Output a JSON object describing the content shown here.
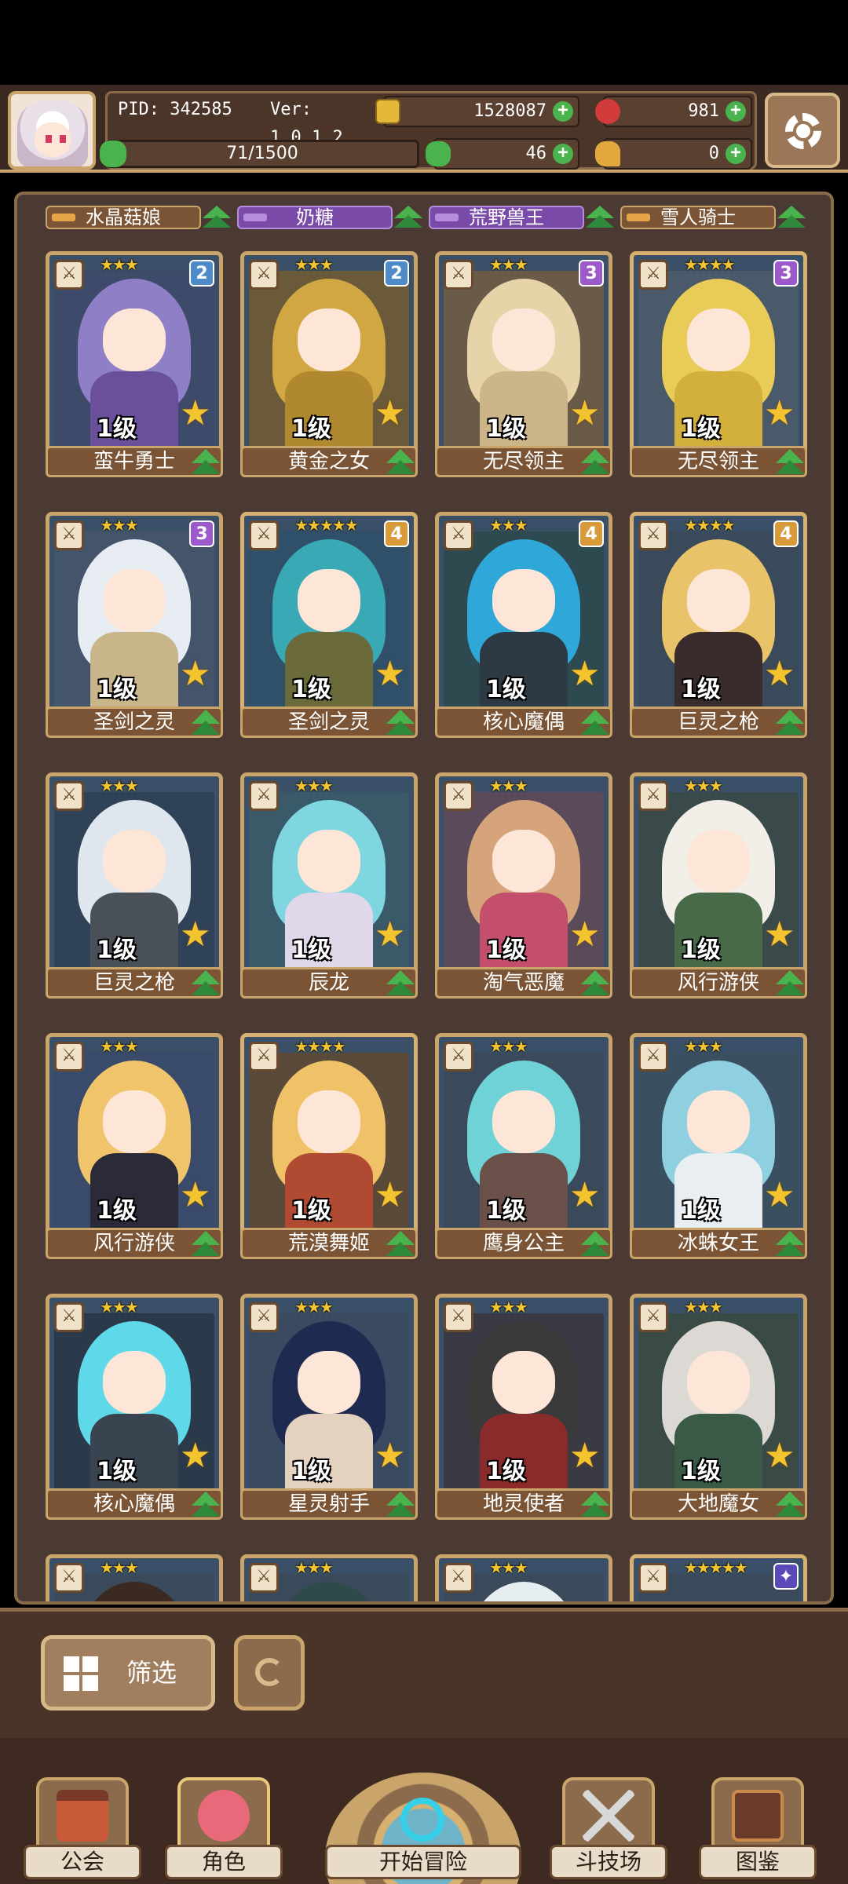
{
  "header": {
    "pid": "PID: 342585",
    "version": "Ver: 1.0.1.2",
    "gold": "1528087",
    "ruby": "981",
    "stamina": "71/1500",
    "clover": "46",
    "chicken": "0"
  },
  "name_row": [
    {
      "name": "水晶菇娘",
      "style": "brown"
    },
    {
      "name": "奶糖",
      "style": "purple"
    },
    {
      "name": "荒野兽王",
      "style": "purple"
    },
    {
      "name": "雪人骑士",
      "style": "brown"
    }
  ],
  "cards": [
    {
      "name": "蛮牛勇士",
      "level": "1级",
      "stars": "★★★",
      "badge": "2",
      "badge_color": "#4f8ac9",
      "hair": "#8e7fc7",
      "bg": "#3d4a6a",
      "body": "#6a4f9a"
    },
    {
      "name": "黄金之女",
      "level": "1级",
      "stars": "★★★",
      "badge": "2",
      "badge_color": "#4f8ac9",
      "hair": "#d1a744",
      "bg": "#6a5a3a",
      "body": "#b08830"
    },
    {
      "name": "无尽领主",
      "level": "1级",
      "stars": "★★★",
      "badge": "3",
      "badge_color": "#9b59c9",
      "hair": "#e7d3a8",
      "bg": "#6a5a48",
      "body": "#cdb58a"
    },
    {
      "name": "无尽领主",
      "level": "1级",
      "stars": "★★★★",
      "badge": "3",
      "badge_color": "#9b59c9",
      "hair": "#e9cc58",
      "bg": "#4a5a6a",
      "body": "#d3b03c"
    },
    {
      "name": "圣剑之灵",
      "level": "1级",
      "stars": "★★★",
      "badge": "3",
      "badge_color": "#9b59c9",
      "hair": "#e7ecf2",
      "bg": "#44546a",
      "body": "#c8b68a"
    },
    {
      "name": "圣剑之灵",
      "level": "1级",
      "stars": "★★★★★",
      "badge": "4",
      "badge_color": "#d99a3a",
      "hair": "#3aa9b6",
      "bg": "#30506a",
      "body": "#6b6a3a"
    },
    {
      "name": "核心魔偶",
      "level": "1级",
      "stars": "★★★",
      "badge": "4",
      "badge_color": "#d99a3a",
      "hair": "#2fa7d8",
      "bg": "#2d4a50",
      "body": "#2d3a44"
    },
    {
      "name": "巨灵之枪",
      "level": "1级",
      "stars": "★★★★",
      "badge": "4",
      "badge_color": "#d99a3a",
      "hair": "#e8c36a",
      "bg": "#3a4a5a",
      "body": "#3a2c2c"
    },
    {
      "name": "巨灵之枪",
      "level": "1级",
      "stars": "★★★",
      "badge": "",
      "badge_color": "",
      "hair": "#dfe6ee",
      "bg": "#2f4258",
      "body": "#4a5058"
    },
    {
      "name": "辰龙",
      "level": "1级",
      "stars": "★★★",
      "badge": "",
      "badge_color": "",
      "hair": "#7fd6e0",
      "bg": "#3a5a6a",
      "body": "#e0d7ea"
    },
    {
      "name": "淘气恶魔",
      "level": "1级",
      "stars": "★★★",
      "badge": "",
      "badge_color": "",
      "hair": "#d5a47a",
      "bg": "#5a4a5a",
      "body": "#c44f6c"
    },
    {
      "name": "风行游侠",
      "level": "1级",
      "stars": "★★★",
      "badge": "",
      "badge_color": "",
      "hair": "#f2efe8",
      "bg": "#3a4a4a",
      "body": "#486a48"
    },
    {
      "name": "风行游侠",
      "level": "1级",
      "stars": "★★★",
      "badge": "",
      "badge_color": "",
      "hair": "#efc46a",
      "bg": "#3a4a6a",
      "body": "#2a2a38"
    },
    {
      "name": "荒漠舞姬",
      "level": "1级",
      "stars": "★★★★",
      "badge": "",
      "badge_color": "",
      "hair": "#f0c268",
      "bg": "#5a4a3a",
      "body": "#b04a32"
    },
    {
      "name": "鹰身公主",
      "level": "1级",
      "stars": "★★★",
      "badge": "",
      "badge_color": "",
      "hair": "#6fd2d6",
      "bg": "#3a4a5a",
      "body": "#6a5048"
    },
    {
      "name": "冰蛛女王",
      "level": "1级",
      "stars": "★★★",
      "badge": "",
      "badge_color": "",
      "hair": "#8fd0e0",
      "bg": "#3a5060",
      "body": "#e8eef2"
    },
    {
      "name": "核心魔偶",
      "level": "1级",
      "stars": "★★★",
      "badge": "",
      "badge_color": "",
      "hair": "#5fd8ea",
      "bg": "#2a3a4a",
      "body": "#3a4450"
    },
    {
      "name": "星灵射手",
      "level": "1级",
      "stars": "★★★",
      "badge": "",
      "badge_color": "",
      "hair": "#1f2a50",
      "bg": "#3a4a60",
      "body": "#e4d2c0"
    },
    {
      "name": "地灵使者",
      "level": "1级",
      "stars": "★★★",
      "badge": "",
      "badge_color": "",
      "hair": "#3a3a3a",
      "bg": "#3a3a44",
      "body": "#8a2a2a"
    },
    {
      "name": "大地魔女",
      "level": "1级",
      "stars": "★★★",
      "badge": "",
      "badge_color": "",
      "hair": "#dcd8d4",
      "bg": "#3a4a44",
      "body": "#3a5a48"
    },
    {
      "name": "",
      "level": "",
      "stars": "★★★",
      "badge": "",
      "badge_color": "",
      "hair": "#3a2a22",
      "bg": "#3a4a5a",
      "body": "#3a4a5a"
    },
    {
      "name": "",
      "level": "",
      "stars": "★★★",
      "badge": "",
      "badge_color": "",
      "hair": "#2e4a4a",
      "bg": "#3a4a5a",
      "body": "#3a4a5a"
    },
    {
      "name": "",
      "level": "",
      "stars": "★★★",
      "badge": "",
      "badge_color": "",
      "hair": "#e6eef2",
      "bg": "#3a4a5a",
      "body": "#3a4a5a"
    },
    {
      "name": "",
      "level": "",
      "stars": "★★★★★",
      "badge": "✦",
      "badge_color": "#5a4ab8",
      "hair": "#3a4a5a",
      "bg": "#3a4a5a",
      "body": "#3a4a5a"
    }
  ],
  "controls": {
    "filter_label": "筛选"
  },
  "nav": {
    "guild": "公会",
    "character": "角色",
    "adventure": "开始冒险",
    "arena": "斗技场",
    "codex": "图鉴"
  }
}
